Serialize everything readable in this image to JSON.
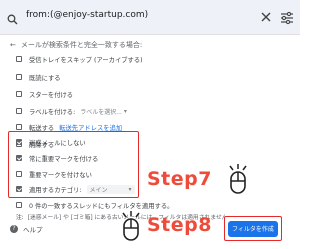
{
  "search": {
    "query": "from:(@enjoy-startup.com)"
  },
  "filter_panel": {
    "back_text": "メールが検索条件と完全一致する場合:",
    "options": [
      {
        "label": "受信トレイをスキップ (アーカイブする)",
        "checked": false
      },
      {
        "label": "既読にする",
        "checked": false
      },
      {
        "label": "スターを付ける",
        "checked": false
      },
      {
        "label": "ラベルを付ける:",
        "checked": false,
        "select": "ラベルを選択..."
      },
      {
        "label": "転送する",
        "checked": false,
        "link": "転送先アドレスを追加"
      },
      {
        "label": "削除する",
        "checked": false
      },
      {
        "label": "迷惑メールにしない",
        "checked": true
      },
      {
        "label": "常に重要マークを付ける",
        "checked": true
      },
      {
        "label": "重要マークを付けない",
        "checked": false
      },
      {
        "label": "適用するカテゴリ:",
        "checked": true,
        "select": "メイン"
      },
      {
        "label": "0 件の一致するスレッドにもフィルタを適用する。",
        "checked": false
      }
    ],
    "footnote_prefix": "注:",
    "footnote": "[迷惑メール] や [ゴミ箱] にある古いメールには、フィルタは適用されません",
    "help_label": "ヘルプ",
    "create_button": "フィルタを作成"
  },
  "annotations": {
    "step7": "Step7",
    "step8": "Step8",
    "accent_color": "#ef4b3a",
    "box_color": "#e62a2a"
  },
  "icons": [
    "search-icon",
    "close-icon",
    "tune-icon",
    "back-arrow-icon",
    "help-icon",
    "mouse-icon"
  ]
}
